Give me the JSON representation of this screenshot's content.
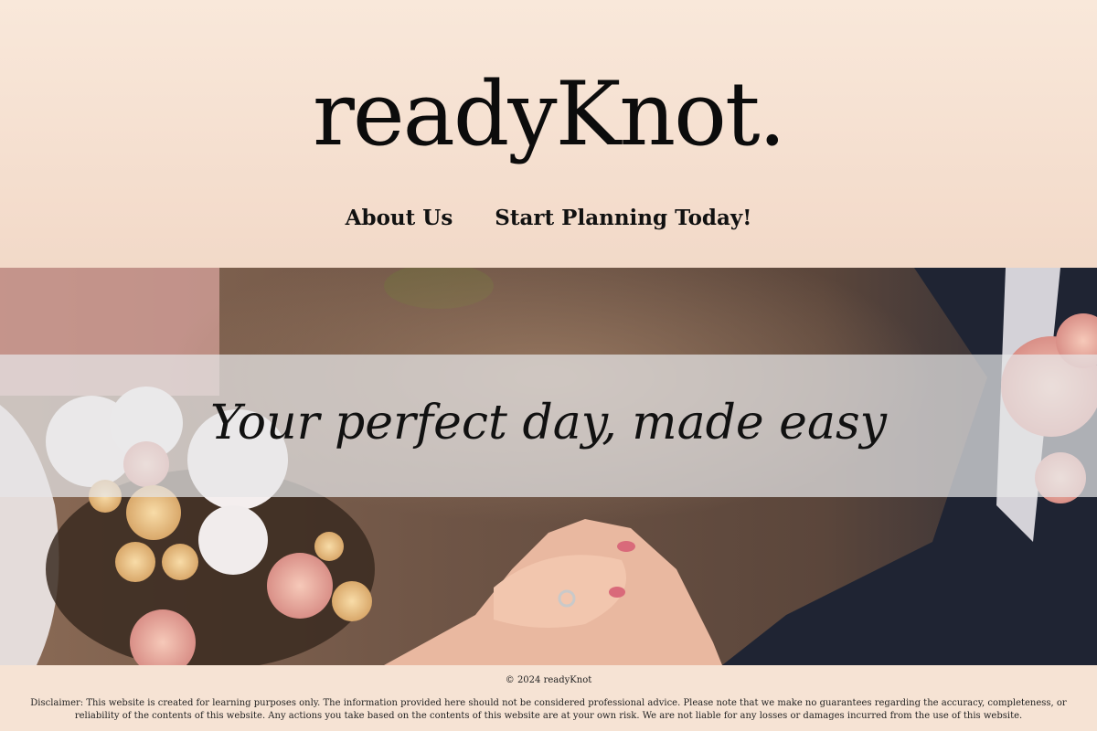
{
  "header": {
    "logo": "readyKnot.",
    "nav": [
      {
        "label": "About Us"
      },
      {
        "label": "Start Planning Today!"
      }
    ]
  },
  "hero": {
    "tagline": "Your perfect day, made easy"
  },
  "footer": {
    "copyright": "© 2024 readyKnot",
    "disclaimer": "Disclaimer: This website is created for learning purposes only. The information provided here should not be considered professional advice. Please note that we make no guarantees regarding the accuracy, completeness, or reliability of the contents of this website. Any actions you take based on the contents of this website are at your own risk. We are not liable for any losses or damages incurred from the use of this website."
  },
  "colors": {
    "header_bg": "#f6e3d4",
    "text": "#111111"
  }
}
